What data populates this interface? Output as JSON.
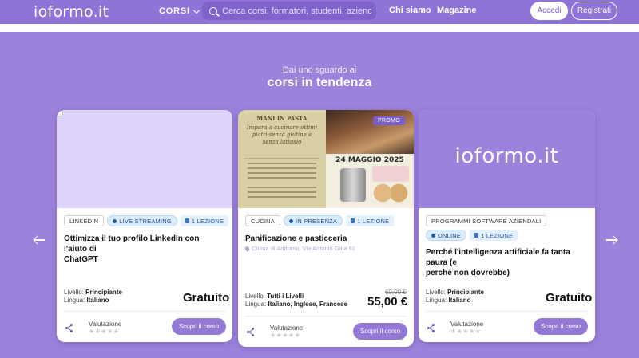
{
  "header": {
    "logo": "ioformo.it",
    "courses_menu": "CORSI",
    "search_placeholder": "Cerca corsi, formatori, studenti, azienc",
    "nav_about": "Chi siamo",
    "nav_magazine": "Magazine",
    "login": "Accedi",
    "register": "Registrati"
  },
  "section": {
    "subheading": "Dai uno sguardo ai",
    "heading": "corsi in tendenza"
  },
  "cards": [
    {
      "tags": [
        "LINKEDIN",
        "LIVE STREAMING",
        "1 LEZIONE"
      ],
      "title_line1": "Ottimizza il tuo profilo LinkedIn con l'aiuto di",
      "title_line2": "ChatGPT",
      "level_label": "Livello:",
      "level": "Principiante",
      "language_label": "Lingua:",
      "language": "Italiano",
      "price": "Gratuito",
      "rating_label": "Valutazione",
      "stars": "★★★★★",
      "button": "Scopri il corso"
    },
    {
      "promo": "PROMO",
      "tags": [
        "CUCINA",
        "IN PRESENZA",
        "1 LEZIONE"
      ],
      "title": "Panificazione e pasticceria",
      "location": "Colma di Andorno, Via Antonio Gaia 61",
      "level_label": "Livello:",
      "level": "Tutti i Livelli",
      "language_label": "Lingua:",
      "language": "Italiano, Inglese, Francese",
      "old_price": "60,00 €",
      "price": "55,00 €",
      "rating_label": "Valutazione",
      "stars": "★★★★★",
      "button": "Scopri il corso",
      "poster": {
        "heading": "MANI IN PASTA",
        "tagline": "Impara a cucinare ottimi piatti senza glutine e senza lattosio",
        "date": "24 MAGGIO 2025"
      }
    },
    {
      "image_logo": "ioformo.it",
      "tags": [
        "PROGRAMMI SOFTWARE AZIENDALI",
        "ONLINE",
        "1 LEZIONE"
      ],
      "title_line1": "Perché l'intelligenza artificiale fa tanta paura (e",
      "title_line2": "perché non dovrebbe)",
      "level_label": "Livello:",
      "level": "Principiante",
      "language_label": "Lingua:",
      "language": "Italiano",
      "price": "Gratuito",
      "rating_label": "Valutazione",
      "stars": "★★★★★",
      "button": "Scopri il corso"
    }
  ],
  "colors": {
    "background": "#9b83dc",
    "header": "#8f74d8",
    "button": "#9378d6",
    "card_image_placeholder": "#ddd3fb"
  }
}
